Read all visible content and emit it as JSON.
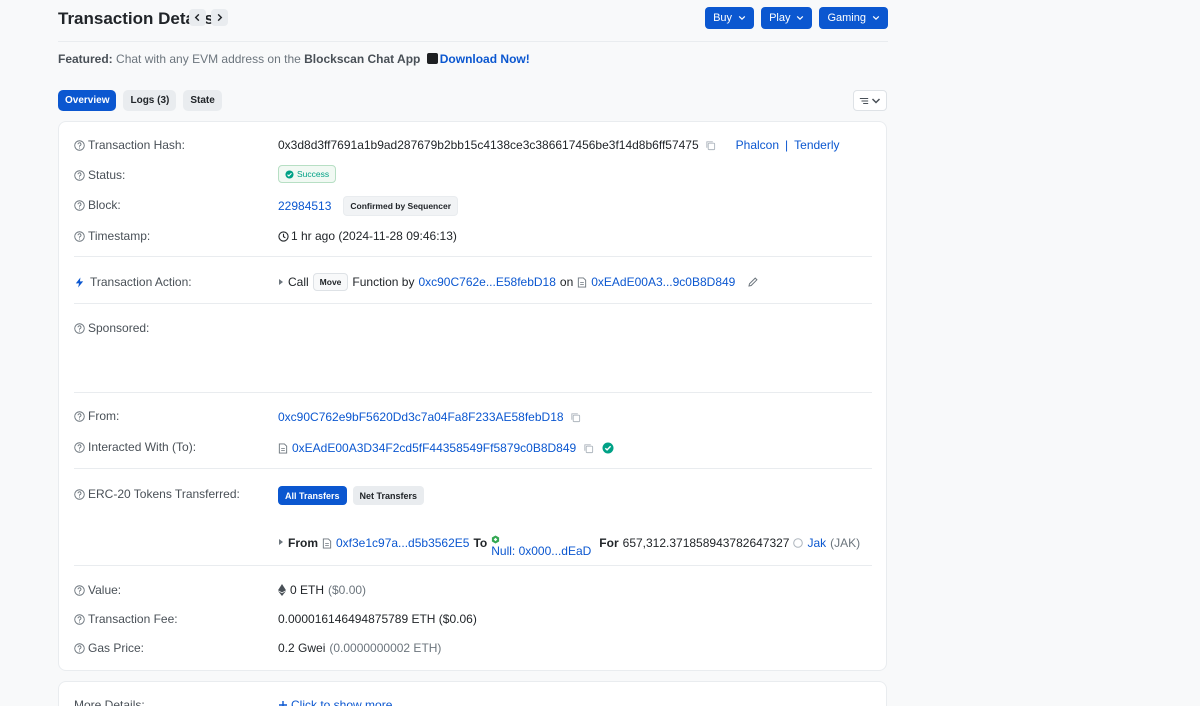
{
  "header": {
    "title": "Transaction Details",
    "buttons": [
      "Buy",
      "Play",
      "Gaming"
    ]
  },
  "featured": {
    "prefix": "Featured:",
    "text": "Chat with any EVM address on the",
    "app": "Blockscan Chat App",
    "cta": "Download Now!"
  },
  "tabs": [
    "Overview",
    "Logs (3)",
    "State"
  ],
  "fields": {
    "hash": {
      "label": "Transaction Hash:",
      "value": "0x3d8d3ff7691a1b9ad287679b2bb15c4138ce3c386617456be3f14d8b6ff57475",
      "tool1": "Phalcon",
      "sep": "|",
      "tool2": "Tenderly"
    },
    "status": {
      "label": "Status:",
      "value": "Success"
    },
    "block": {
      "label": "Block:",
      "value": "22984513",
      "badge": "Confirmed by Sequencer"
    },
    "timestamp": {
      "label": "Timestamp:",
      "value": "1 hr ago (2024-11-28 09:46:13)"
    },
    "action": {
      "label": "Transaction Action:",
      "call": "Call",
      "method": "Move",
      "by": "Function by",
      "from": "0xc90C762e...E58febD18",
      "on": "on",
      "contract": "0xEAdE00A3...9c0B8D849"
    },
    "sponsored": {
      "label": "Sponsored:"
    },
    "from": {
      "label": "From:",
      "value": "0xc90C762e9bF5620Dd3c7a04Fa8F233AE58febD18"
    },
    "to": {
      "label": "Interacted With (To):",
      "value": "0xEAdE00A3D34F2cd5fF44358549Ff5879c0B8D849"
    },
    "erc20": {
      "label": "ERC-20 Tokens Transferred:",
      "pills": [
        "All Transfers",
        "Net Transfers"
      ],
      "from_label": "From",
      "from": "0xf3e1c97a...d5b3562E5",
      "to_label": "To",
      "to": "Null: 0x000...dEaD",
      "for_label": "For",
      "amount": "657,312.371858943782647327",
      "token": "Jak",
      "symbol": "(JAK)"
    },
    "value": {
      "label": "Value:",
      "eth": "0 ETH",
      "usd": "($0.00)"
    },
    "fee": {
      "label": "Transaction Fee:",
      "value": "0.000016146494875789 ETH ($0.06)"
    },
    "gas": {
      "label": "Gas Price:",
      "gwei": "0.2 Gwei",
      "eth": "(0.0000000002 ETH)"
    }
  },
  "more": {
    "label": "More Details:",
    "cta": "Click to show more"
  },
  "colors": {
    "primary": "#0b57d0",
    "success": "#00a186"
  }
}
